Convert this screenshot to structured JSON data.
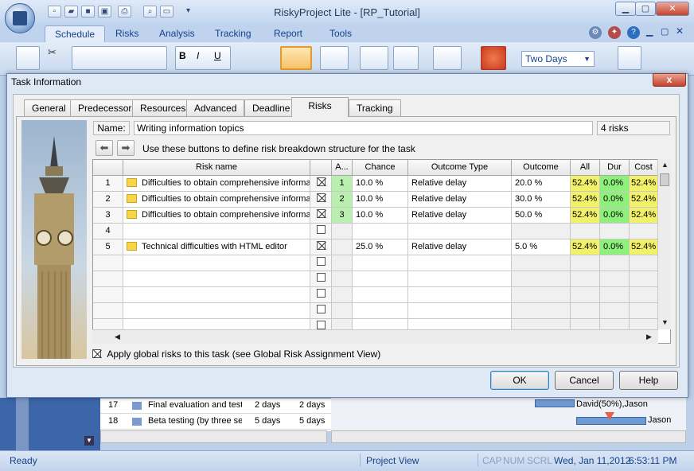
{
  "app": {
    "title": "RiskyProject Lite - [RP_Tutorial]",
    "ribbon_tabs": [
      "Schedule",
      "Risks",
      "Analysis",
      "Tracking",
      "Report",
      "Tools"
    ],
    "active_tab": "Schedule",
    "zoom_value": "Two Days"
  },
  "dialog": {
    "title": "Task Information",
    "close_label": "x",
    "tabs": [
      "General",
      "Predecessors",
      "Resources",
      "Advanced",
      "Deadline",
      "Risks",
      "Tracking"
    ],
    "active_tab": "Risks",
    "name_label": "Name:",
    "name_value": "Writing information topics",
    "risk_count": "4 risks",
    "nav_hint": "Use these buttons to define risk breakdown structure for the task",
    "columns": [
      "Risk name",
      "A...",
      "Chance",
      "Outcome Type",
      "Outcome",
      "All",
      "Dur",
      "Cost"
    ],
    "rows": [
      {
        "num": "1",
        "name": "Difficulties to obtain comprehensive informa",
        "checked": true,
        "a": "1",
        "chance": "10.0 %",
        "type": "Relative delay",
        "outcome": "20.0 %",
        "all": "52.4%",
        "dur": "0.0%",
        "cost": "52.4%"
      },
      {
        "num": "2",
        "name": "Difficulties to obtain comprehensive informa",
        "checked": true,
        "a": "2",
        "chance": "10.0 %",
        "type": "Relative delay",
        "outcome": "30.0 %",
        "all": "52.4%",
        "dur": "0.0%",
        "cost": "52.4%"
      },
      {
        "num": "3",
        "name": "Difficulties to obtain comprehensive informa",
        "checked": true,
        "a": "3",
        "chance": "10.0 %",
        "type": "Relative delay",
        "outcome": "50.0 %",
        "all": "52.4%",
        "dur": "0.0%",
        "cost": "52.4%"
      },
      {
        "num": "4",
        "name": "",
        "checked": false,
        "a": "",
        "chance": "",
        "type": "",
        "outcome": "",
        "all": "",
        "dur": "",
        "cost": ""
      },
      {
        "num": "5",
        "name": "Technical difficulties with HTML editor",
        "checked": true,
        "a": "",
        "chance": "25.0 %",
        "type": "Relative delay",
        "outcome": "5.0 %",
        "all": "52.4%",
        "dur": "0.0%",
        "cost": "52.4%"
      }
    ],
    "apply_global_label": "Apply global risks to this task (see Global Risk Assignment View)",
    "apply_global_checked": true,
    "ok_label": "OK",
    "cancel_label": "Cancel",
    "help_label": "Help"
  },
  "background_tasks": [
    {
      "num": "17",
      "name": "Final evaluation and testi",
      "duration": "2 days",
      "duration2": "2 days"
    },
    {
      "num": "18",
      "name": "Beta testing (by three se",
      "duration": "5 days",
      "duration2": "5 days"
    }
  ],
  "gantt_labels": [
    "David(50%),Jason",
    "Jason"
  ],
  "statusbar": {
    "ready": "Ready",
    "view": "Project View",
    "caps": "CAP",
    "num": "NUM",
    "scrl": "SCRL",
    "date": "Wed, Jan 11,2012",
    "time": "6:53:11 PM"
  },
  "colors": {
    "accent": "#15428b",
    "highlight_yellow": "#f2f26a",
    "highlight_green": "#8ef07a",
    "a_column_green": "#b9f0b0"
  }
}
